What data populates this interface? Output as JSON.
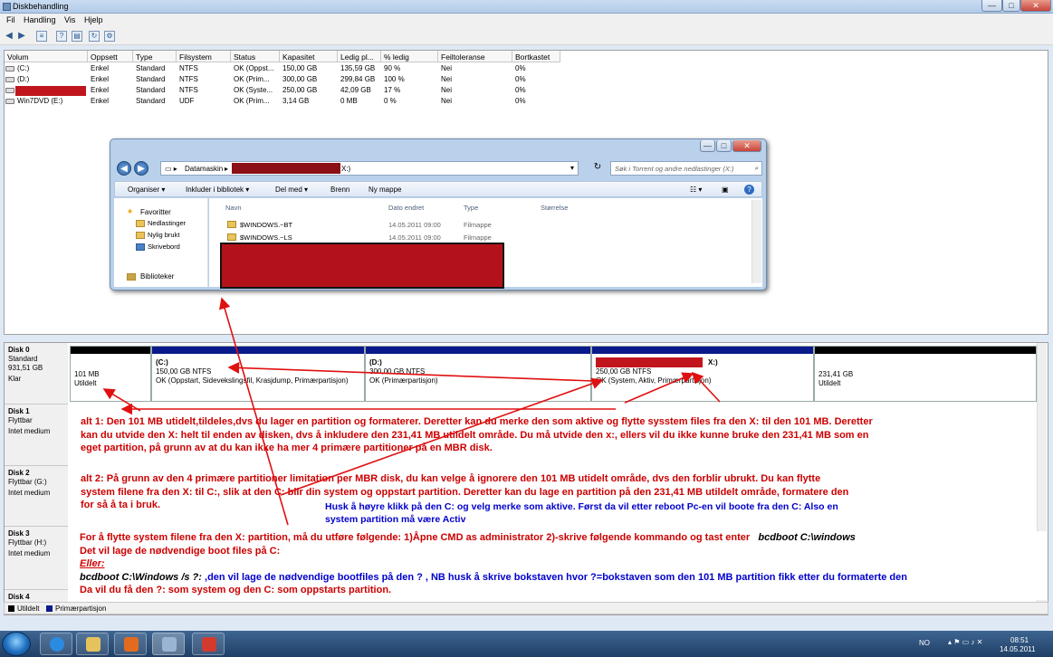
{
  "window": {
    "title": "Diskbehandling",
    "controls": {
      "minimize": "—",
      "maximize": "□",
      "close": "✕"
    }
  },
  "menu": [
    "Fil",
    "Handling",
    "Vis",
    "Hjelp"
  ],
  "toolbar": {
    "icons": [
      "back-arrow-icon",
      "forward-arrow-icon",
      "list-view-icon",
      "help-icon",
      "properties-icon",
      "refresh-icon"
    ],
    "help_label": "?"
  },
  "volumes": {
    "headers": [
      "Volum",
      "Oppsett",
      "Type",
      "Filsystem",
      "Status",
      "Kapasitet",
      "Ledig pl...",
      "% ledig",
      "Feiltoleranse",
      "Bortkastet"
    ],
    "rows": [
      [
        "(C:)",
        "Enkel",
        "Standard",
        "NTFS",
        "OK (Oppst...",
        "150,00 GB",
        "135,59 GB",
        "90 %",
        "Nei",
        "0%"
      ],
      [
        "(D:)",
        "Enkel",
        "Standard",
        "NTFS",
        "OK (Prim...",
        "300,00 GB",
        "299,84 GB",
        "100 %",
        "Nei",
        "0%"
      ],
      [
        "",
        "Enkel",
        "Standard",
        "NTFS",
        "OK (Syste...",
        "250,00 GB",
        "42,09 GB",
        "17 %",
        "Nei",
        "0%"
      ],
      [
        "Win7DVD (E:)",
        "Enkel",
        "Standard",
        "UDF",
        "OK (Prim...",
        "3,14 GB",
        "0 MB",
        "0 %",
        "Nei",
        "0%"
      ]
    ]
  },
  "explorer": {
    "breadcrumb_root": "Datamaskin",
    "breadcrumb_drive": "X:)",
    "search_placeholder": "Søk i Torrent og andre nedlastinger (X:)",
    "commands": [
      "Organiser ▾",
      "Inkluder i bibliotek ▾",
      "Del med ▾",
      "Brenn",
      "Ny mappe"
    ],
    "nav": {
      "favorites": "Favoritter",
      "items": [
        "Nedlastinger",
        "Nylig brukt",
        "Skrivebord"
      ],
      "libraries": "Biblioteker"
    },
    "columns": [
      "Navn",
      "Dato endret",
      "Type",
      "Størrelse"
    ],
    "files": [
      {
        "name": "$WINDOWS.~BT",
        "date": "14.05.2011 09:00",
        "type": "Filmappe"
      },
      {
        "name": "$WINDOWS.~LS",
        "date": "14.05.2011 09:00",
        "type": "Filmappe"
      }
    ]
  },
  "disks": [
    {
      "name": "Disk 0",
      "lines": [
        "Standard",
        "931,51 GB",
        "Klar"
      ],
      "partitions": [
        {
          "label": "",
          "size": "101 MB",
          "status": "Utildelt"
        },
        {
          "label": "(C:)",
          "size": "150,00 GB NTFS",
          "status": "OK (Oppstart, Sidevekslingsfil, Krasjdump, Primærpartisjon)"
        },
        {
          "label": "(D:)",
          "size": "300,00 GB NTFS",
          "status": "OK (Primærpartisjon)"
        },
        {
          "label": "X:)",
          "size": "250,00 GB NTFS",
          "status": "OK (System, Aktiv, Primærpartisjon)"
        },
        {
          "label": "",
          "size": "231,41 GB",
          "status": "Utildelt"
        }
      ]
    },
    {
      "name": "Disk 1",
      "lines": [
        "Flyttbar",
        "",
        "Intet medium"
      ]
    },
    {
      "name": "Disk 2",
      "lines": [
        "Flyttbar (G:)",
        "",
        "Intet medium"
      ]
    },
    {
      "name": "Disk 3",
      "lines": [
        "Flyttbar (H:)",
        "",
        "Intet medium"
      ]
    },
    {
      "name": "Disk 4",
      "lines": []
    }
  ],
  "notes": {
    "alt1": "alt 1: Den 101 MB utidelt,tildeles,dvs du lager en partition og formaterer. Deretter kan du merke den som aktive og flytte sysstem files fra den X: til den 101 MB. Deretter kan du utvide den X: helt til enden av disken, dvs å inkludere den 231,41 MB utildelt område. Du må utvide den x:, ellers vil du ikke kunne bruke den 231,41 MB som en eget partition, på grunn av at du kan ikke ha mer 4 primære partitioner på en MBR disk.",
    "alt2": "alt 2: På grunn av den 4 primære partitioner limitation per MBR disk, du kan velge å ignorere den 101 MB utidelt område, dvs  den forblir ubrukt. Du kan flytte system filene fra den X: til C:, slik at den C: blir din system og oppstart partition. Deretter kan du lage en partition på den 231,41 MB utildelt område, formatere den for så å ta i bruk.",
    "blue": "Husk å høyre klikk på den C: og velg merke som aktive. Først da vil etter reboot Pc-en vil boote fra den C: Also en system partition må være Activ",
    "howto_l1": "For å flytte system filene fra den X: partition, må du utføre følgende:   1)Åpne CMD as administrator 2)-skrive følgende kommando og tast enter",
    "howto_cmd1": "bcdboot  C:\\windows",
    "howto_l2": "Det vil lage de nødvendige boot files på C:",
    "howto_or": "Eller:",
    "howto_cmd2": "bcdboot C:\\Windows  /s  ?:",
    "howto_l3": "  ,den vil lage de nødvendige bootfiles på den  ? , NB husk å skrive bokstaven hvor ?=bokstaven som den 101 MB partition fikk etter du formaterte den",
    "howto_l4": "Da vil du få den ?: som system  og den  C: som oppstarts partition."
  },
  "legend": {
    "unallocated": "Utildelt",
    "primary": "Primærpartisjon"
  },
  "taskbar": {
    "lang": "NO",
    "time": "08:51",
    "date": "14.05.2011"
  },
  "colors": {
    "annotation": "#cc0000",
    "blue_note": "#0000cc",
    "primary_bar": "#0a1a8a",
    "unallocated_bar": "#000000"
  }
}
